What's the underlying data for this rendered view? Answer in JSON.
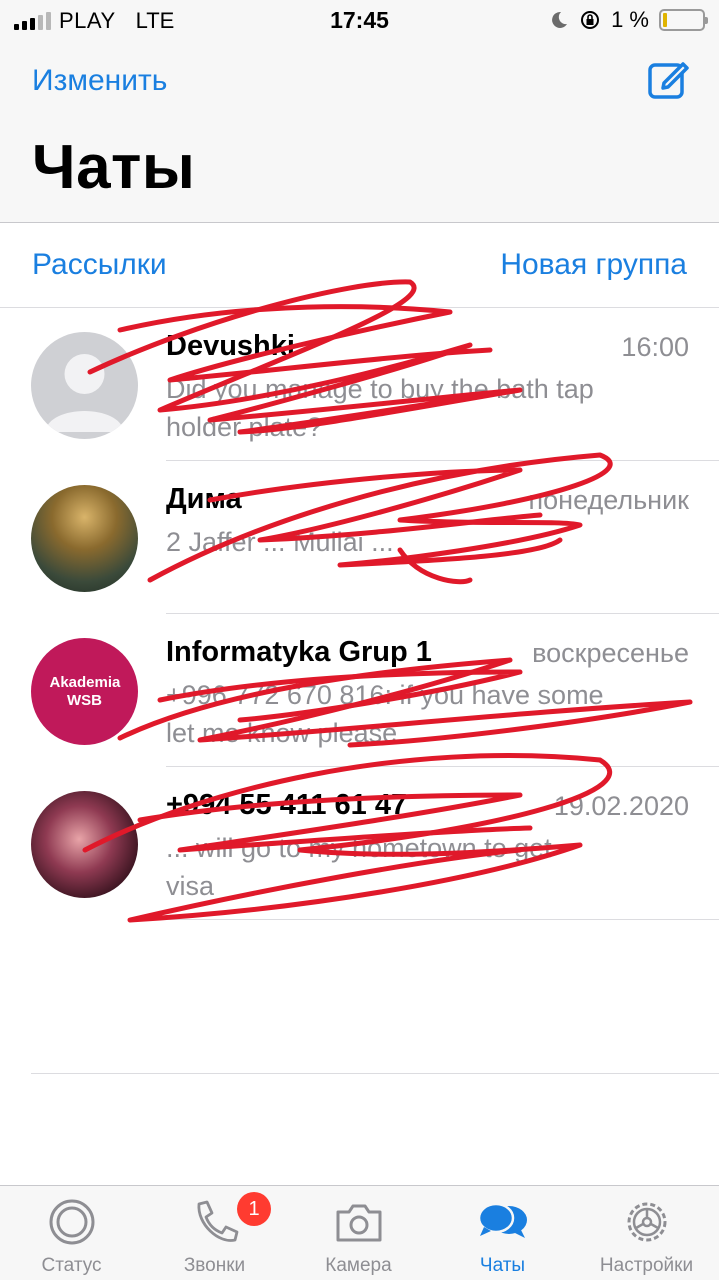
{
  "status_bar": {
    "carrier": "PLAY",
    "network": "LTE",
    "time": "17:45",
    "battery": "1 %",
    "icons": [
      "signal-icon",
      "moon-icon",
      "rotation-lock-icon",
      "battery-icon"
    ]
  },
  "header": {
    "edit_label": "Изменить",
    "title": "Чаты",
    "compose_icon": "compose-icon"
  },
  "lists": {
    "broadcasts_label": "Рассылки",
    "new_group_label": "Новая группа"
  },
  "chats": [
    {
      "name": "Devushki",
      "time": "16:00",
      "message": "Did you manage to buy the bath tap holder plate?"
    },
    {
      "name": "Дима",
      "time": "понедельник",
      "message": "2 Jaffer ... Mullai ..."
    },
    {
      "name": "Informatyka Grup 1",
      "time": "воскресенье",
      "message": "+996 772 670 816: if you have some let me know please",
      "avatar_text": "Akademia WSB"
    },
    {
      "name": "+994 55 411 61 47",
      "time": "19.02.2020",
      "message": "... will go to my hometown to get visa"
    }
  ],
  "tabbar": {
    "tabs": [
      {
        "label": "Статус",
        "icon": "status-icon"
      },
      {
        "label": "Звонки",
        "icon": "phone-icon",
        "badge": "1"
      },
      {
        "label": "Камера",
        "icon": "camera-icon"
      },
      {
        "label": "Чаты",
        "icon": "chats-icon",
        "active": true
      },
      {
        "label": "Настройки",
        "icon": "settings-gear-icon"
      }
    ]
  },
  "colors": {
    "accent": "#1a7fe0",
    "secondary_text": "#8e8e93",
    "badge": "#ff3b30",
    "scribble": "#e0192a",
    "wsb_avatar": "#c0195a"
  }
}
